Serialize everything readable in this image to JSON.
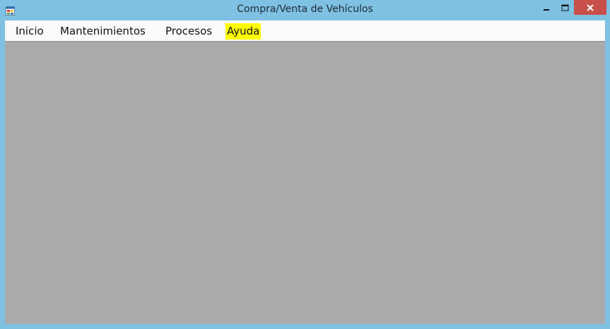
{
  "window": {
    "title": "Compra/Venta de Vehículos",
    "icon": "app-form-icon",
    "controls": {
      "minimize_icon": "minimize-icon",
      "maximize_icon": "maximize-icon",
      "close_icon": "close-icon"
    }
  },
  "menu": {
    "items": [
      {
        "label": "Inicio"
      },
      {
        "label": "Mantenimientos"
      },
      {
        "label": "Procesos"
      },
      {
        "label": "Ayuda",
        "highlighted": true
      }
    ]
  },
  "colors": {
    "frame": "#7fc1e3",
    "close_button": "#c7504a",
    "menubar": "#fbfbfb",
    "highlight": "#ffff00",
    "workspace": "#ababab"
  }
}
